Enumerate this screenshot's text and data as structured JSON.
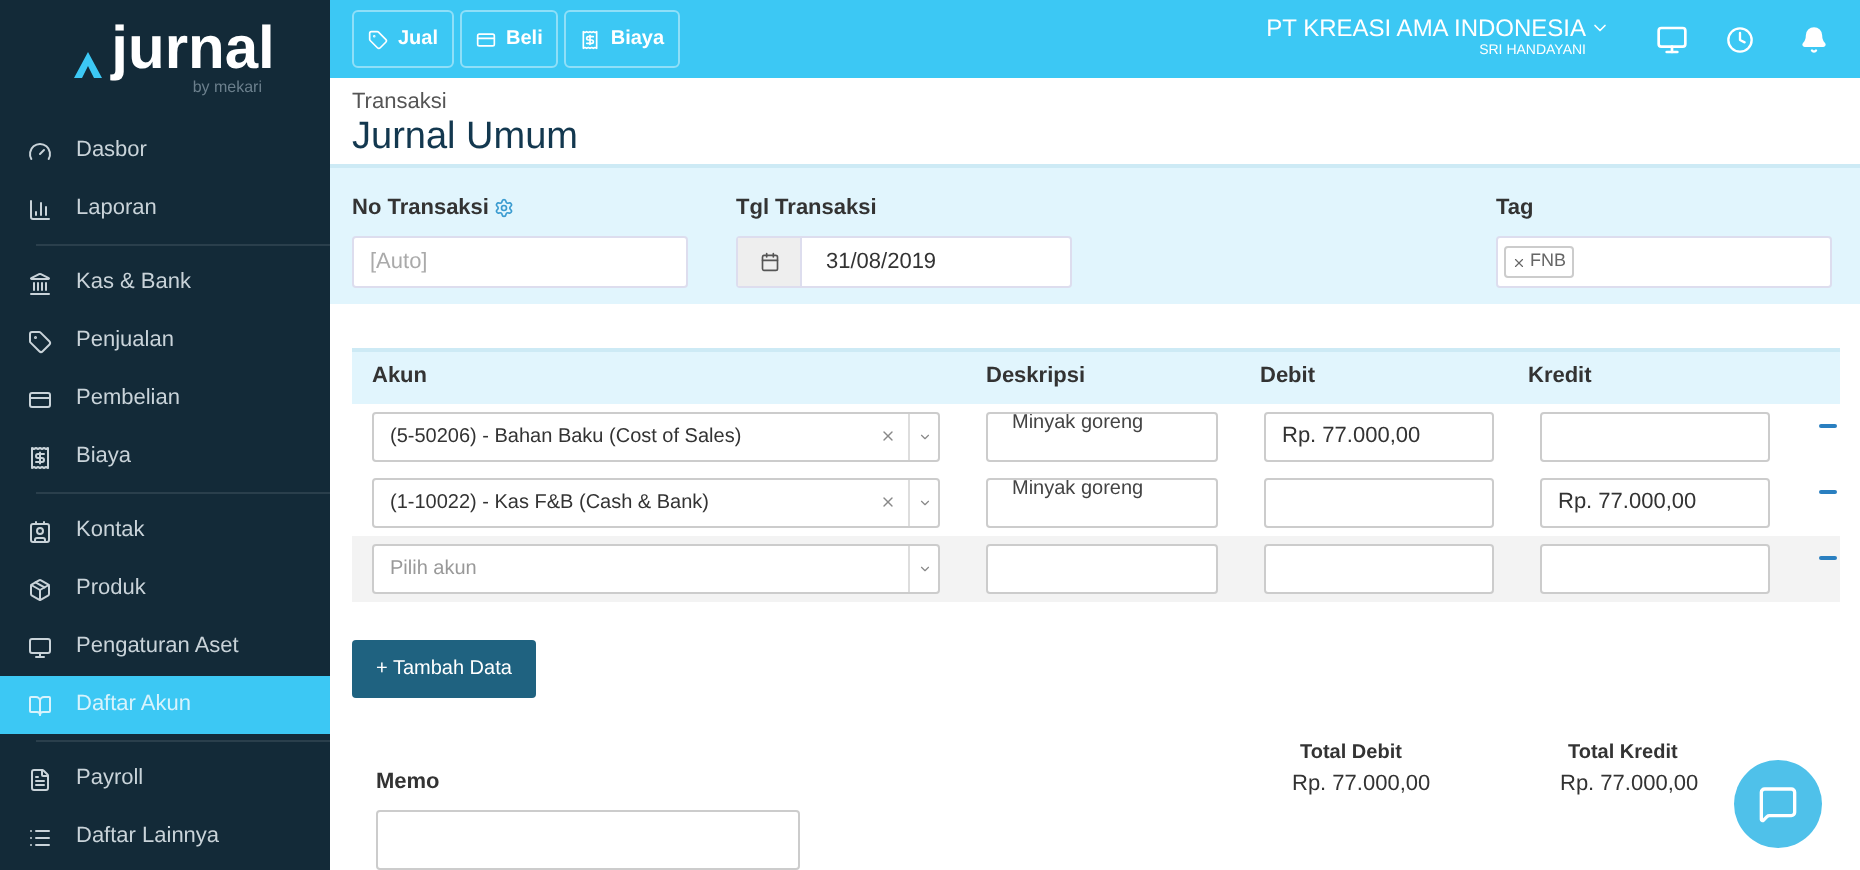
{
  "sidebar": {
    "logo": "jurnal",
    "logo_sub": "by mekari",
    "groups": [
      [
        {
          "label": "Dasbor",
          "selected": false
        },
        {
          "label": "Laporan",
          "selected": false
        }
      ],
      [
        {
          "label": "Kas & Bank",
          "selected": false
        },
        {
          "label": "Penjualan",
          "selected": false
        },
        {
          "label": "Pembelian",
          "selected": false
        },
        {
          "label": "Biaya",
          "selected": false
        }
      ],
      [
        {
          "label": "Kontak",
          "selected": false
        },
        {
          "label": "Produk",
          "selected": false
        },
        {
          "label": "Pengaturan Aset",
          "selected": false
        },
        {
          "label": "Daftar Akun",
          "selected": true
        }
      ],
      [
        {
          "label": "Payroll",
          "selected": false
        },
        {
          "label": "Daftar Lainnya",
          "selected": false
        }
      ]
    ]
  },
  "topbar": {
    "quick_buttons": [
      {
        "label": "Jual"
      },
      {
        "label": "Beli"
      },
      {
        "label": "Biaya"
      }
    ],
    "company": "PT KREASI AMA INDONESIA",
    "user": "SRI HANDAYANI"
  },
  "page": {
    "breadcrumb": "Transaksi",
    "title": "Jurnal Umum"
  },
  "form": {
    "no_label": "No Transaksi",
    "no_placeholder": "[Auto]",
    "date_label": "Tgl Transaksi",
    "date_value": "31/08/2019",
    "tag_label": "Tag",
    "tags": [
      "FNB"
    ]
  },
  "table": {
    "columns": [
      "Akun",
      "Deskripsi",
      "Debit",
      "Kredit"
    ],
    "rows": [
      {
        "account": "(5-50206) - Bahan Baku (Cost of Sales)",
        "description": "Minyak goreng",
        "debit": "Rp. 77.000,00"
      },
      {
        "account": "(1-10022) - Kas F&B (Cash & Bank)",
        "description": "Minyak goreng",
        "credit": "Rp. 77.000,00"
      },
      {
        "placeholder": "Pilih akun"
      }
    ]
  },
  "add_button": "+ Tambah Data",
  "memo_label": "Memo",
  "totals": [
    {
      "label": "Total Debit",
      "value": "Rp. 77.000,00"
    },
    {
      "label": "Total Kredit",
      "value": "Rp. 77.000,00"
    }
  ]
}
